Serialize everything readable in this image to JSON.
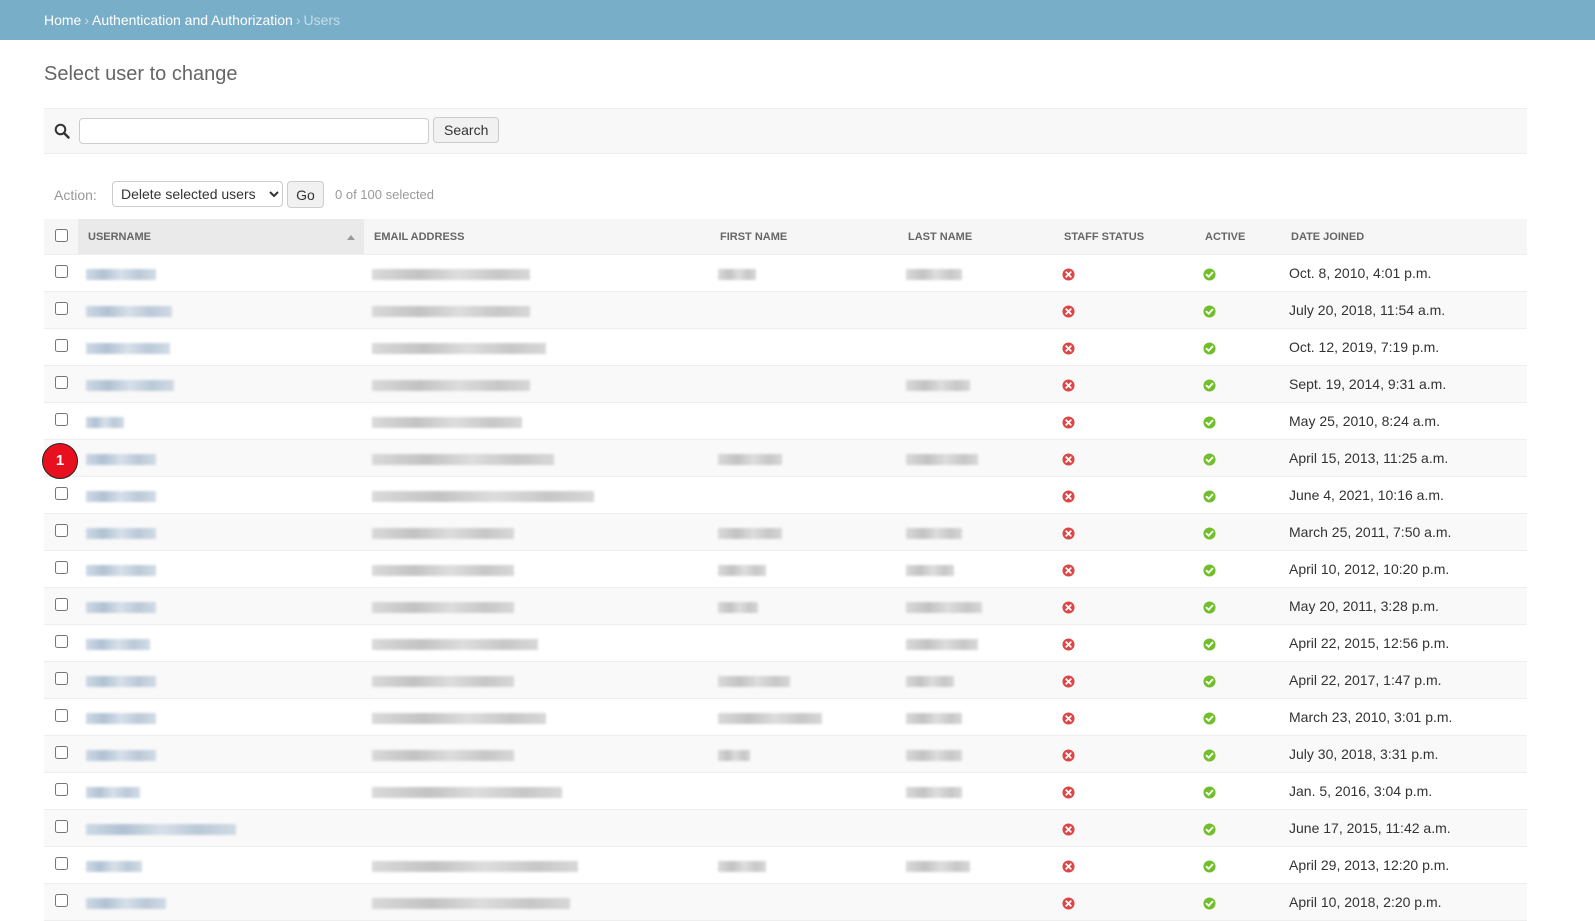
{
  "breadcrumb": {
    "home": "Home",
    "section": "Authentication and Authorization",
    "current": "Users",
    "separator": "›"
  },
  "page": {
    "title": "Select user to change"
  },
  "search": {
    "value": "",
    "placeholder": "",
    "button_label": "Search",
    "icon": "search-icon"
  },
  "actions": {
    "label": "Action:",
    "selected_option": "Delete selected users",
    "go_label": "Go",
    "counter": "0 of 100 selected"
  },
  "table": {
    "columns": [
      "Username",
      "Email address",
      "First name",
      "Last name",
      "Staff status",
      "Active",
      "Date joined"
    ],
    "sorted_column": "Username",
    "rows": [
      {
        "staff": false,
        "active": true,
        "date": "Oct. 8, 2010, 4:01 p.m."
      },
      {
        "staff": false,
        "active": true,
        "date": "July 20, 2018, 11:54 a.m."
      },
      {
        "staff": false,
        "active": true,
        "date": "Oct. 12, 2019, 7:19 p.m."
      },
      {
        "staff": false,
        "active": true,
        "date": "Sept. 19, 2014, 9:31 a.m."
      },
      {
        "staff": false,
        "active": true,
        "date": "May 25, 2010, 8:24 a.m."
      },
      {
        "staff": false,
        "active": true,
        "date": "April 15, 2013, 11:25 a.m."
      },
      {
        "staff": false,
        "active": true,
        "date": "June 4, 2021, 10:16 a.m."
      },
      {
        "staff": false,
        "active": true,
        "date": "March 25, 2011, 7:50 a.m."
      },
      {
        "staff": false,
        "active": true,
        "date": "April 10, 2012, 10:20 p.m."
      },
      {
        "staff": false,
        "active": true,
        "date": "May 20, 2011, 3:28 p.m."
      },
      {
        "staff": false,
        "active": true,
        "date": "April 22, 2015, 12:56 p.m."
      },
      {
        "staff": false,
        "active": true,
        "date": "April 22, 2017, 1:47 p.m."
      },
      {
        "staff": false,
        "active": true,
        "date": "March 23, 2010, 3:01 p.m."
      },
      {
        "staff": false,
        "active": true,
        "date": "July 30, 2018, 3:31 p.m."
      },
      {
        "staff": false,
        "active": true,
        "date": "Jan. 5, 2016, 3:04 p.m."
      },
      {
        "staff": false,
        "active": true,
        "date": "June 17, 2015, 11:42 a.m."
      },
      {
        "staff": false,
        "active": true,
        "date": "April 29, 2013, 12:20 p.m."
      },
      {
        "staff": false,
        "active": true,
        "date": "April 10, 2018, 2:20 p.m."
      }
    ]
  },
  "marker": {
    "label": "1"
  },
  "colors": {
    "header_bar": "#79aec8",
    "link": "#447e9b",
    "no": "#dd4646",
    "yes": "#70bf2b"
  }
}
